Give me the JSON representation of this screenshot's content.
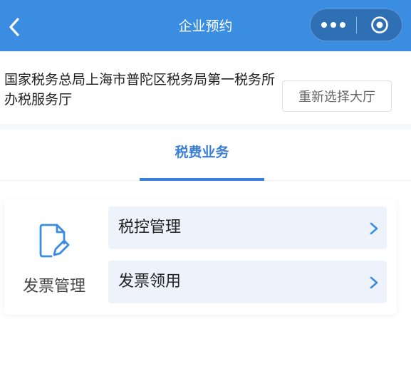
{
  "nav": {
    "title": "企业预约",
    "back_icon": "chevron-left-icon",
    "more_icon": "more-dots-icon",
    "close_icon": "target-circle-icon",
    "bg_color": "#3a8de0"
  },
  "hall": {
    "name": "国家税务总局上海市普陀区税务局第一税务所办税服务厅",
    "reselect_label": "重新选择大厅"
  },
  "tabs": [
    {
      "label": "税费业务",
      "active": true
    }
  ],
  "category": {
    "label": "发票管理",
    "icon": "document-edit-icon",
    "items": [
      {
        "label": "税控管理",
        "icon": "chevron-right-icon"
      },
      {
        "label": "发票领用",
        "icon": "chevron-right-icon"
      }
    ]
  },
  "colors": {
    "accent": "#3a7fd5",
    "item_bg": "#eef3fb"
  }
}
